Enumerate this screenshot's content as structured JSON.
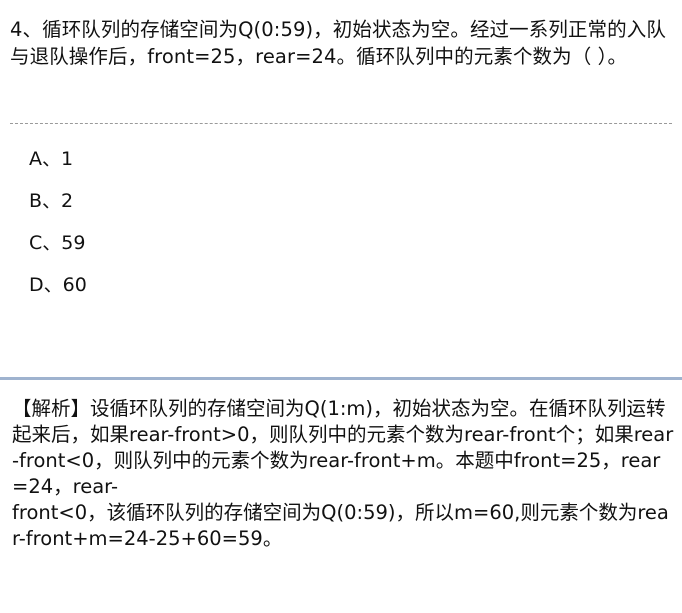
{
  "question": {
    "text": "4、循环队列的存储空间为Q(0:59)，初始状态为空。经过一系列正常的入队与退队操作后，front=25，rear=24。循环队列中的元素个数为（ ）。"
  },
  "options": [
    {
      "label": "A、1"
    },
    {
      "label": "B、2"
    },
    {
      "label": "C、59"
    },
    {
      "label": "D、60"
    }
  ],
  "analysis": {
    "text": "【解析】设循环队列的存储空间为Q(1:m)，初始状态为空。在循环队列运转起来后，如果rear-front>0，则队列中的元素个数为rear-front个；如果rear-front<0，则队列中的元素个数为rear-front+m。本题中front=25，rear=24，rear-\nfront<0，该循环队列的存储空间为Q(0:59)，所以m=60,则元素个数为rear-front+m=24-25+60=59。"
  }
}
